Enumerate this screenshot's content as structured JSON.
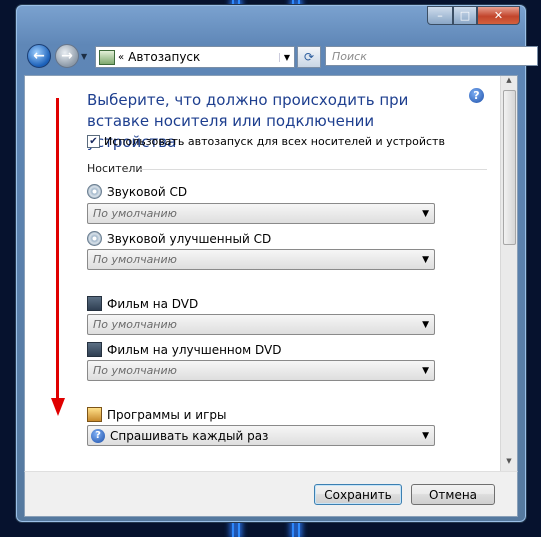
{
  "window": {
    "caption": {
      "minimize_glyph": "–",
      "maximize_glyph": "□",
      "close_glyph": "✕"
    }
  },
  "nav": {
    "back_icon": "back-arrow-icon",
    "forward_icon": "forward-arrow-icon",
    "address_prefix": "«",
    "address_text": "Автозапуск",
    "search_placeholder": "Поиск"
  },
  "content": {
    "title": "Выберите, что должно происходить при вставке носителя или подключении устройства",
    "use_autoplay_checked": true,
    "use_autoplay_label": "Использовать автозапуск для всех носителей и устройств",
    "section_title": "Носители",
    "items": [
      {
        "label": "Звуковой CD",
        "icon": "audio-cd-icon",
        "value": "По умолчанию"
      },
      {
        "label": "Звуковой улучшенный CD",
        "icon": "enhanced-audio-cd-icon",
        "value": "По умолчанию"
      },
      {
        "label": "Фильм на DVD",
        "icon": "dvd-movie-icon",
        "value": "По умолчанию"
      },
      {
        "label": "Фильм на улучшенном DVD",
        "icon": "enhanced-dvd-movie-icon",
        "value": "По умолчанию"
      },
      {
        "label": "Программы и игры",
        "icon": "software-games-icon",
        "value": "Спрашивать каждый раз"
      }
    ]
  },
  "footer": {
    "save_label": "Сохранить",
    "cancel_label": "Отмена"
  },
  "colors": {
    "accent": "#1e3f8f",
    "annotation_arrow": "#e00000"
  }
}
